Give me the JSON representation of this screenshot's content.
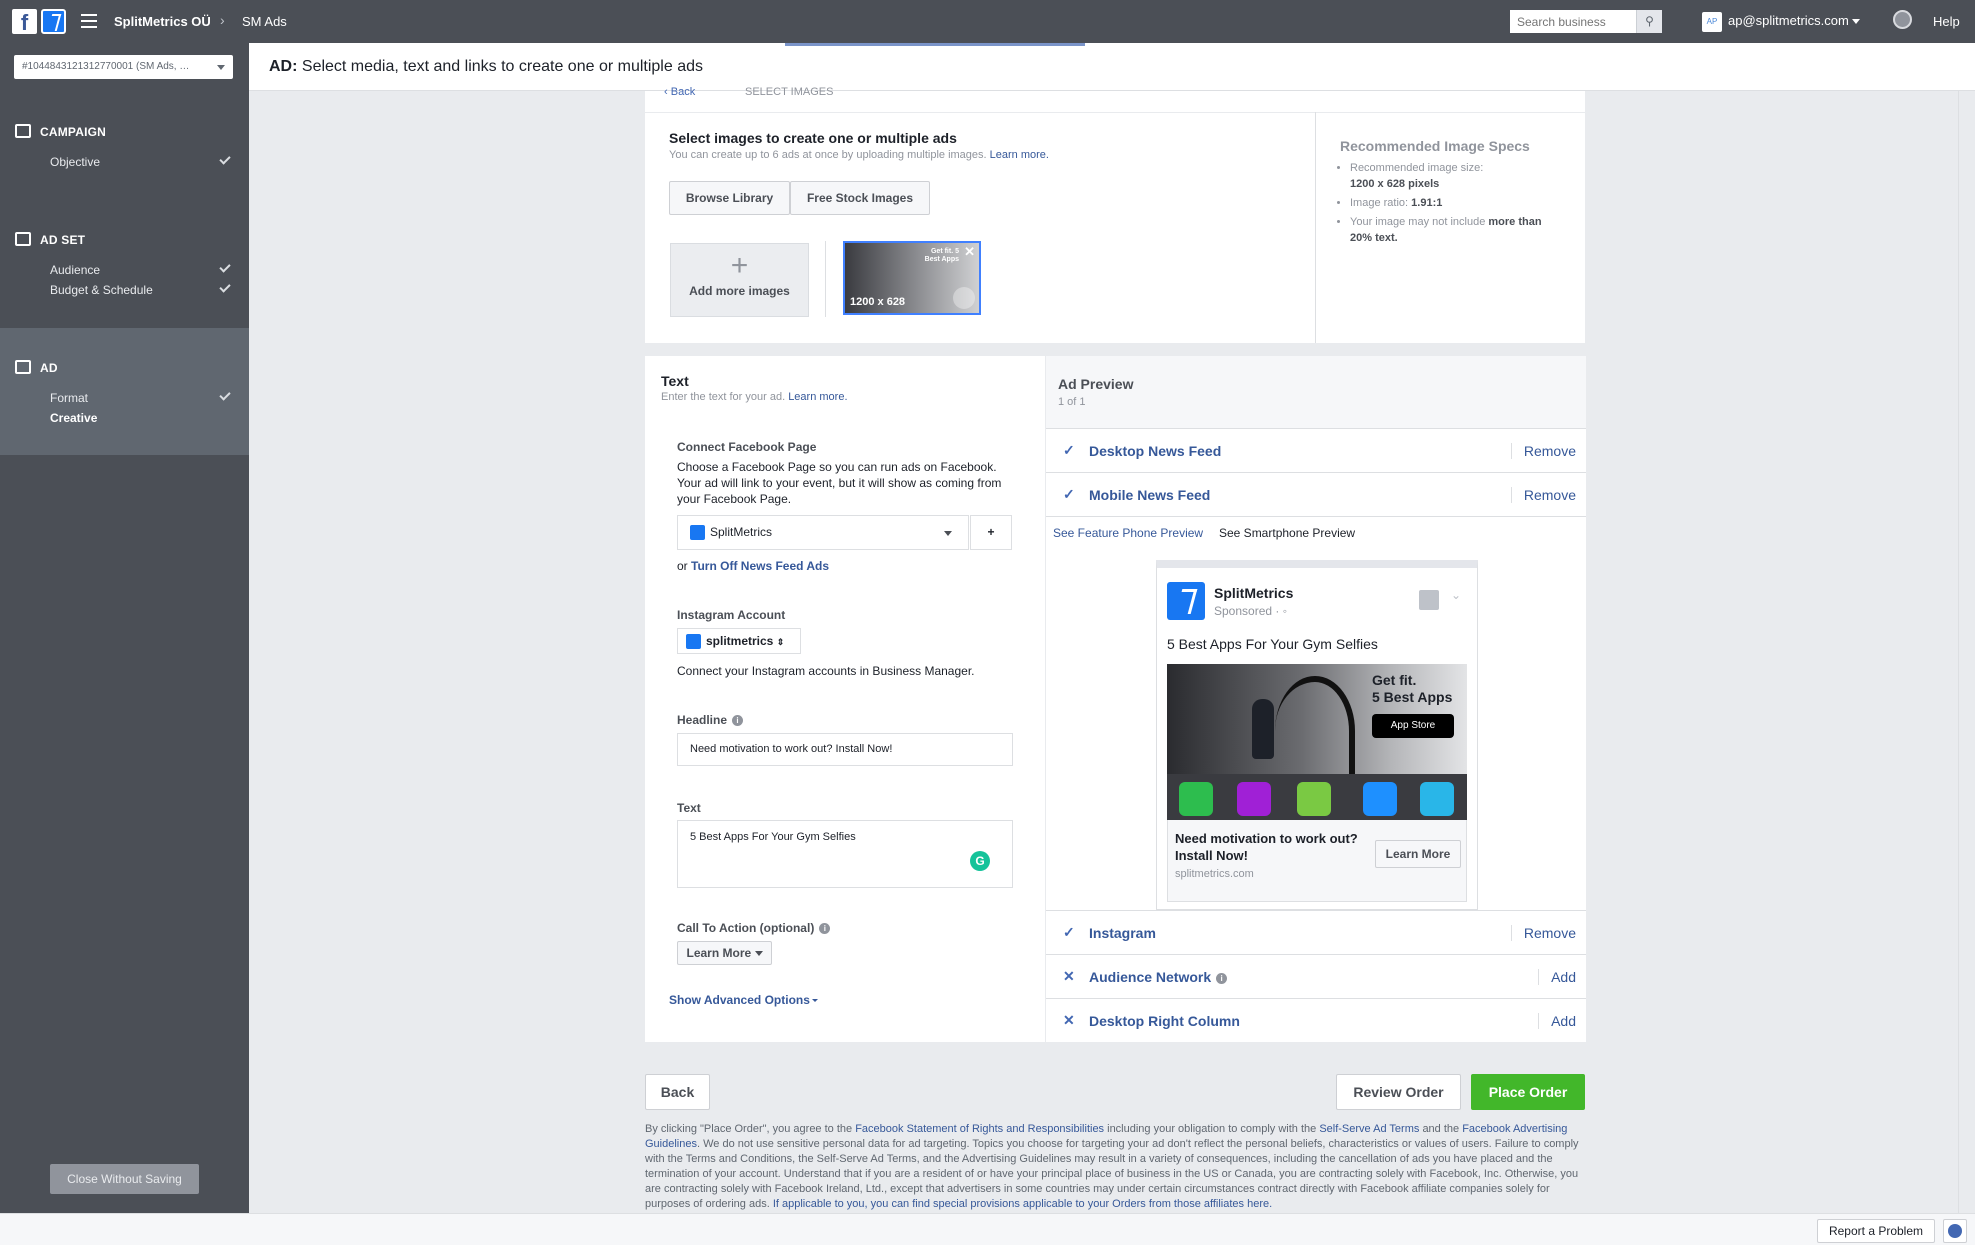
{
  "topbar": {
    "company": "SplitMetrics OÜ",
    "section": "SM Ads",
    "search_placeholder": "Search business",
    "user_initials": "AP",
    "user_email": "ap@splitmetrics.com",
    "help": "Help"
  },
  "sidebar": {
    "account_selector": "#1044843121312770001 (SM Ads, …",
    "campaign": {
      "title": "CAMPAIGN",
      "items": [
        "Objective"
      ]
    },
    "adset": {
      "title": "AD SET",
      "items": [
        "Audience",
        "Budget & Schedule"
      ]
    },
    "ad": {
      "title": "AD",
      "items": [
        "Format",
        "Creative"
      ]
    },
    "close_button": "Close Without Saving"
  },
  "header": {
    "prefix": "AD:",
    "title": "Select media, text and links to create one or multiple ads"
  },
  "images": {
    "back": "Back",
    "crumb": "SELECT IMAGES",
    "title": "Select images to create one or multiple ads",
    "subtitle": "You can create up to 6 ads at once by uploading multiple images.",
    "learn_more": "Learn more.",
    "browse_library": "Browse Library",
    "free_stock": "Free Stock Images",
    "add_more": "Add more images",
    "thumb_dims": "1200 x 628",
    "thumb_text": "Get fit. 5 Best Apps"
  },
  "specs": {
    "title": "Recommended Image Specs",
    "size_label": "Recommended image size:",
    "size_value": "1200 x 628 pixels",
    "ratio_label": "Image ratio:",
    "ratio_value": "1.91:1",
    "text_label": "Your image may not include",
    "text_value": "more than 20% text."
  },
  "text_panel": {
    "title": "Text",
    "subtitle": "Enter the text for your ad.",
    "learn_more": "Learn more.",
    "connect_label": "Connect Facebook Page",
    "connect_desc": "Choose a Facebook Page so you can run ads on Facebook. Your ad will link to your event, but it will show as coming from your Facebook Page.",
    "page_value": "SplitMetrics",
    "add_page": "+",
    "or": "or",
    "turn_off": "Turn Off News Feed Ads",
    "instagram_label": "Instagram Account",
    "instagram_value": "splitmetrics",
    "instagram_desc": "Connect your Instagram accounts in Business Manager.",
    "headline_label": "Headline",
    "headline_value": "Need motivation to work out? Install Now!",
    "text_label": "Text",
    "text_value": "5 Best Apps For Your Gym Selfies",
    "cta_label": "Call To Action (optional)",
    "cta_value": "Learn More",
    "advanced": "Show Advanced Options"
  },
  "preview": {
    "title": "Ad Preview",
    "count": "1 of 1",
    "placements": [
      {
        "name": "Desktop News Feed",
        "action": "Remove",
        "state": "check"
      },
      {
        "name": "Mobile News Feed",
        "action": "Remove",
        "state": "check"
      }
    ],
    "feature_phone": "See Feature Phone Preview",
    "smartphone": "See Smartphone Preview",
    "post": {
      "page": "SplitMetrics",
      "sponsored": "Sponsored · ",
      "text": "5 Best Apps For Your Gym Selfies",
      "img_line1": "Get fit.",
      "img_line2": "5 Best Apps",
      "app_store": "App Store",
      "headline": "Need motivation to work out? Install Now!",
      "domain": "splitmetrics.com",
      "cta": "Learn More"
    },
    "placements_bottom": [
      {
        "name": "Instagram",
        "action": "Remove",
        "state": "check"
      },
      {
        "name": "Audience Network",
        "action": "Add",
        "state": "x"
      },
      {
        "name": "Desktop Right Column",
        "action": "Add",
        "state": "x"
      }
    ]
  },
  "footer": {
    "back": "Back",
    "review": "Review Order",
    "place": "Place Order",
    "legal_1": "By clicking \"Place Order\", you agree to the",
    "legal_link1": "Facebook Statement of Rights and Responsibilities",
    "legal_2": "including your obligation to comply with the",
    "legal_link2": "Self-Serve Ad Terms",
    "legal_3": "and the",
    "legal_link3": "Facebook Advertising Guidelines",
    "legal_4": ". We do not use sensitive personal data for ad targeting. Topics you choose for targeting your ad don't reflect the personal beliefs, characteristics or values of users. Failure to comply with the Terms and Conditions, the Self-Serve Ad Terms, and the Advertising Guidelines may result in a variety of consequences, including the cancellation of ads you have placed and the termination of your account. Understand that if you are a resident of or have your principal place of business in the US or Canada, you are contracting solely with Facebook, Inc. Otherwise, you are contracting solely with Facebook Ireland, Ltd., except that advertisers in some countries may under certain circumstances contract directly with Facebook affiliate companies solely for purposes of ordering ads.",
    "legal_link4": "If applicable to you, you can find special provisions applicable to your Orders from those affiliates here."
  },
  "bottombar": {
    "report": "Report a Problem"
  },
  "colors": {
    "topbar": "#4b4f56",
    "link": "#365899",
    "place_order": "#42b72a",
    "brand_blue": "#1877f2"
  }
}
